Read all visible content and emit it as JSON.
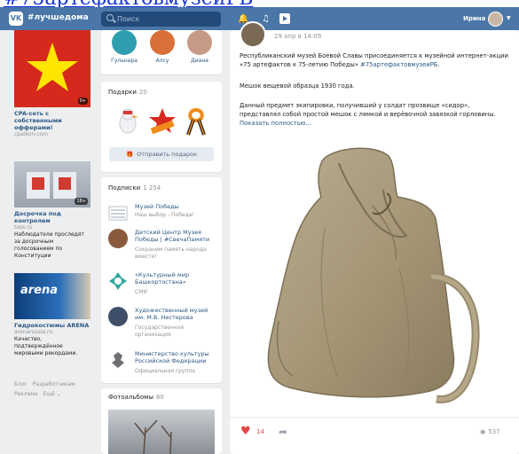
{
  "top_link": {
    "text": "#75артефактовмузеиРБ"
  },
  "header": {
    "logo_text": "VK",
    "brand": "#лучшедома",
    "search_placeholder": "Поиск",
    "user_name": "Ирина",
    "icons": [
      "vk-logo-icon",
      "search-icon",
      "bell-icon",
      "music-icon",
      "play-icon",
      "chevron-down-icon"
    ]
  },
  "ads": [
    {
      "title": "CPA-сеть с собственными офферами!",
      "domain": "cpaikon.com",
      "description": "",
      "badge": "0+"
    },
    {
      "title": "Досрочка под контролем",
      "domain": "tass.ru",
      "description": "Наблюдатели проследят за досрочным голосованием по Конституции",
      "badge": "18+"
    },
    {
      "title": "Гидрокостюмы ARENA",
      "domain": "arenarussia.ru",
      "description": "Качество, подтверждённое мировыми рекордами.",
      "badge": "",
      "image_text": "arena"
    }
  ],
  "footer_links": [
    "Блог",
    "Разработчикам",
    "Реклама",
    "Ещё"
  ],
  "friends": [
    {
      "name": "Гульнара"
    },
    {
      "name": "Алсу"
    },
    {
      "name": "Диана"
    }
  ],
  "gifts": {
    "title": "Подарки",
    "count": "20",
    "send_label": "Отправить подарок"
  },
  "subscriptions": {
    "title": "Подписки",
    "count": "1 254",
    "items": [
      {
        "name": "Музей Победы",
        "desc": "Наш выбор - Победа!"
      },
      {
        "name": "Детский Центр Музея Победы | #СвечаПамяти",
        "desc": "Сохраним память народа вместе!"
      },
      {
        "name": "«Культурный мир Башкортостана»",
        "desc": "СМИ"
      },
      {
        "name": "Художественный музей им. М.В. Нестерова",
        "desc": "Государственная организация"
      },
      {
        "name": "Министерство культуры Российской Федерации",
        "desc": "Официальная группа"
      }
    ]
  },
  "albums": {
    "title": "Фотоальбомы",
    "count": "60"
  },
  "post": {
    "date": "29 апр в 14:09",
    "paragraph1": "Республиканский музей Боевой Славы присоединяется к музейной интернет-акции «75 артефактов к 75-летию Победы»",
    "hashtag": "#75артефактовмузеиРБ.",
    "paragraph2": "Мешок вещевой образца 1930 года.",
    "paragraph3": "Данный предмет экипировки, получивший у солдат прозвище «сидор», представлял собой простой мешок с лямкой и верёвочной завязкой горловины.",
    "show_more": "Показать полностью...",
    "likes": "14",
    "views": "537"
  }
}
